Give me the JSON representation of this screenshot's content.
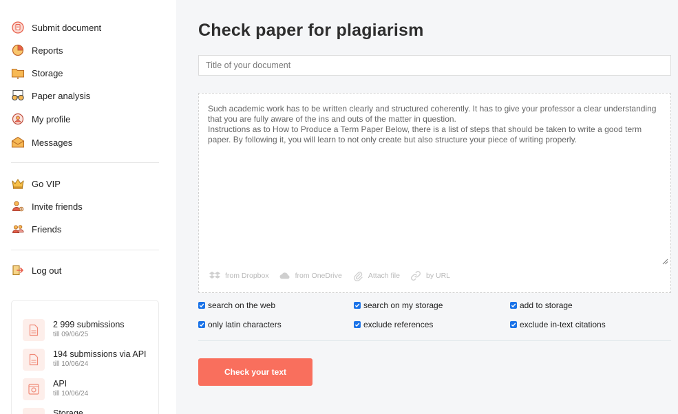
{
  "sidebar": {
    "primary_items": [
      {
        "label": "Submit document",
        "icon": "submit-document-icon"
      },
      {
        "label": "Reports",
        "icon": "reports-pie-icon"
      },
      {
        "label": "Storage",
        "icon": "storage-folder-icon"
      },
      {
        "label": "Paper analysis",
        "icon": "paper-analysis-glasses-icon"
      },
      {
        "label": "My profile",
        "icon": "profile-icon"
      },
      {
        "label": "Messages",
        "icon": "envelope-icon"
      }
    ],
    "secondary_items": [
      {
        "label": "Go VIP",
        "icon": "crown-icon"
      },
      {
        "label": "Invite friends",
        "icon": "invite-friends-icon"
      },
      {
        "label": "Friends",
        "icon": "friends-icon"
      }
    ],
    "logout": {
      "label": "Log out",
      "icon": "logout-icon"
    },
    "plan": [
      {
        "count": "2 999",
        "suffix": "submissions",
        "till": "till 09/06/25",
        "icon": "document-icon"
      },
      {
        "count": "194",
        "suffix": "submissions via API",
        "till": "till 10/06/24",
        "icon": "document-icon"
      },
      {
        "count": "API",
        "suffix": "",
        "till": "till 10/06/24",
        "icon": "api-gear-icon"
      },
      {
        "count": "Storage",
        "suffix": "",
        "till": "",
        "icon": "storage-icon"
      }
    ]
  },
  "main": {
    "title": "Check paper for plagiarism",
    "document_title_placeholder": "Title of your document",
    "document_title_value": "",
    "paper_text": "Such academic work has to be written clearly and structured coherently. It has to give your professor a clear understanding that you are fully aware of the ins and outs of the matter in question.\nInstructions as to How to Produce a Term Paper Below, there is a list of steps that should be taken to write a good term paper. By following it, you will learn to not only create but also structure your piece of writing properly.",
    "sources": [
      {
        "label": "from Dropbox",
        "icon": "dropbox-icon"
      },
      {
        "label": "from OneDrive",
        "icon": "onedrive-cloud-icon"
      },
      {
        "label": "Attach file",
        "icon": "paperclip-icon"
      },
      {
        "label": "by URL",
        "icon": "link-icon"
      }
    ],
    "options": [
      {
        "label": "search on the web",
        "checked": true
      },
      {
        "label": "search on my storage",
        "checked": true
      },
      {
        "label": "add to storage",
        "checked": true
      },
      {
        "label": "only latin characters",
        "checked": true
      },
      {
        "label": "exclude references",
        "checked": true
      },
      {
        "label": "exclude in-text citations",
        "checked": true
      }
    ],
    "submit_label": "Check your text"
  },
  "colors": {
    "accent": "#f96f5d",
    "checkbox": "#1a73e8",
    "icon_orange": "#f4a53a",
    "icon_red": "#e8604c"
  }
}
